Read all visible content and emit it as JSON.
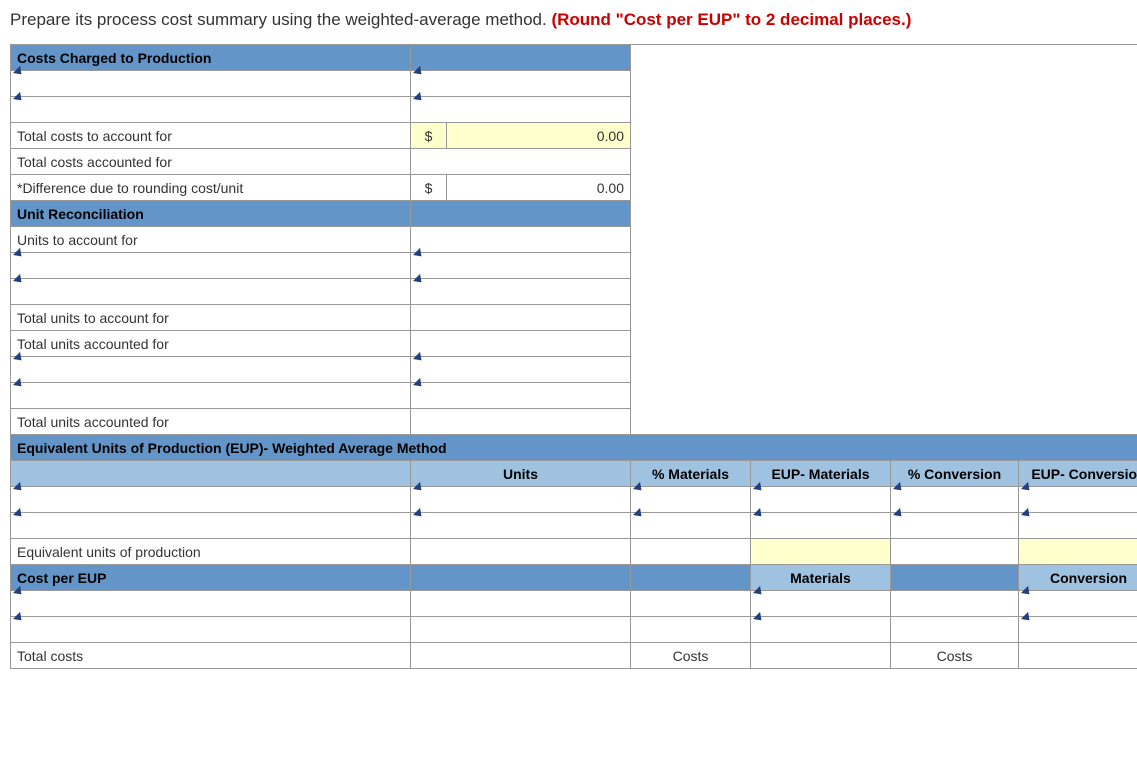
{
  "instruction": {
    "text_prefix": "Prepare its process cost summary using the weighted-average method. ",
    "text_red": "(Round \"Cost per EUP\" to 2 decimal places.)"
  },
  "sections": {
    "costs_charged": "Costs Charged to Production",
    "total_costs_account_for": "Total costs to account for",
    "total_costs_accounted_for": "Total costs accounted for",
    "diff_rounding": "*Difference due to rounding cost/unit",
    "unit_recon": "Unit Reconciliation",
    "units_to_account_for": "Units to account for",
    "total_units_account_for": "Total units to account for",
    "total_units_accounted_for": "Total units accounted for",
    "eup_header": "Equivalent Units of Production (EUP)- Weighted Average Method",
    "eup_row": "Equivalent units of production",
    "cost_per_eup": "Cost per EUP",
    "total_costs": "Total costs"
  },
  "columns": {
    "units": "Units",
    "pct_materials": "% Materials",
    "eup_materials": "EUP- Materials",
    "pct_conversion": "% Conversion",
    "eup_conversion": "EUP- Conversion",
    "materials": "Materials",
    "conversion": "Conversion",
    "costs": "Costs"
  },
  "symbols": {
    "dollar": "$"
  },
  "values": {
    "zero": "0.00"
  }
}
